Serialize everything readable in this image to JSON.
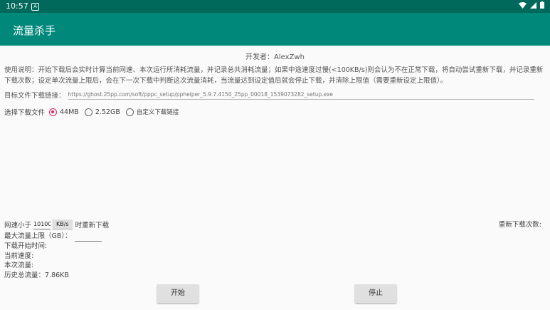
{
  "status_bar": {
    "time": "10:57",
    "notification_glyph": "A"
  },
  "app_bar": {
    "title": "流量杀手"
  },
  "developer": "开发者：AlexZwh",
  "instructions": "使用说明：开始下载后会实时计算当前网速、本次运行所消耗流量，并记录总共消耗流量；如果中途速度过慢(<100KB/s)则会认为不在正常下载，将自动尝试重新下载，并记录重新下载次数；设定单次流量上限后，会在下一次下载中判断这次流量消耗，当流量达到设定值后就会停止下载，并清除上限值（需要重新设定上限值）。",
  "target_url": {
    "label": "目标文件下载链接：",
    "placeholder": "https://ghost.25pp.com/soft/pppc_setup/pphelper_5.9.7.4150_25pp_00018_1539073282_setup.exe"
  },
  "file_select": {
    "label": "选择下载文件",
    "options": [
      "44MB",
      "2.52GB",
      "自定义下载链接"
    ],
    "selected": "44MB"
  },
  "speed": {
    "before": "网速小于",
    "value": "10100",
    "unit": "KB/s",
    "after": "时重新下载"
  },
  "retry_count_label": "重新下载次数:",
  "stats": {
    "max_traffic": "最大流量上限（GB）：",
    "start_time": "下载开始时间:",
    "current_speed": "当前速度:",
    "session_traffic": "本次流量:",
    "total_traffic": "历史总流量：7.86KB"
  },
  "buttons": {
    "start": "开始",
    "stop": "停止"
  },
  "colors": {
    "status_bar": "#00695c",
    "app_bar": "#00897b",
    "accent": "#e91e63"
  }
}
